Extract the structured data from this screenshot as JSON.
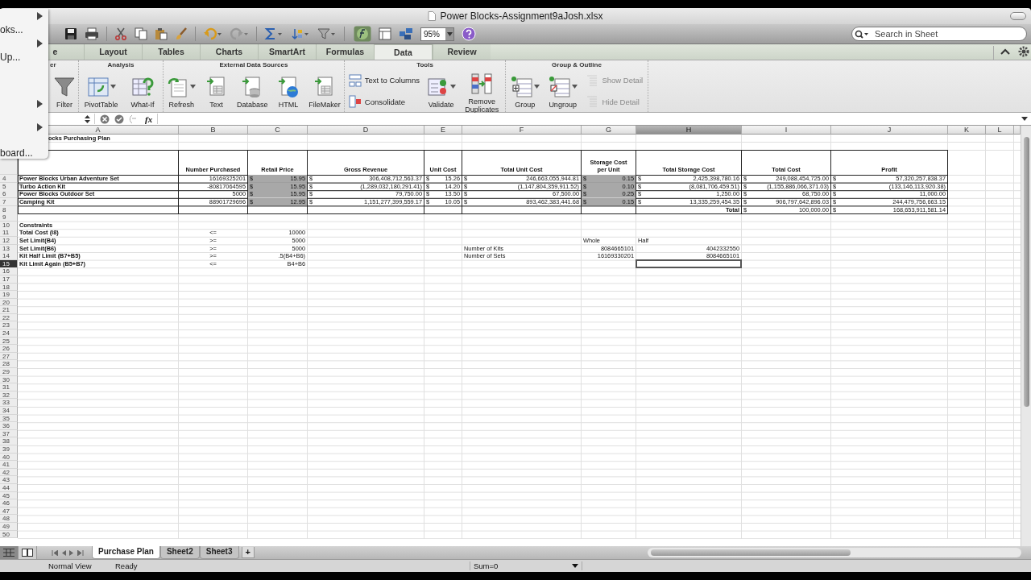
{
  "window": {
    "title": "Power Blocks-Assignment9aJosh.xlsx"
  },
  "menu": [
    {
      "submenu": true
    },
    {
      "label": "oks...",
      "submenu": false
    },
    {
      "submenu": true
    },
    {
      "label": "Up...",
      "submenu": false
    },
    {
      "submenu": true
    },
    {
      "submenu": true
    },
    {
      "label": "board...",
      "submenu": false
    }
  ],
  "toolbar": {
    "zoom": "95%"
  },
  "search": {
    "placeholder": "Search in Sheet"
  },
  "ribbon_tabs": [
    {
      "label": "e",
      "selected": false
    },
    {
      "label": "Layout",
      "selected": false
    },
    {
      "label": "Tables",
      "selected": false
    },
    {
      "label": "Charts",
      "selected": false
    },
    {
      "label": "SmartArt",
      "selected": false
    },
    {
      "label": "Formulas",
      "selected": false
    },
    {
      "label": "Data",
      "selected": true
    },
    {
      "label": "Review",
      "selected": false
    }
  ],
  "ribbon_groups": [
    {
      "title": "er",
      "items": [
        {
          "label": "Filter",
          "kind": "large",
          "dropdown": false,
          "disabled": false
        }
      ]
    },
    {
      "title": "Analysis",
      "items": [
        {
          "label": "PivotTable",
          "kind": "large",
          "dropdown": true,
          "disabled": false
        },
        {
          "label": "What-If",
          "kind": "large",
          "dropdown": false,
          "disabled": false
        }
      ]
    },
    {
      "title": "External Data Sources",
      "items": [
        {
          "label": "Refresh",
          "kind": "large",
          "dropdown": true,
          "disabled": false
        },
        {
          "label": "Text",
          "kind": "large",
          "dropdown": false,
          "disabled": false
        },
        {
          "label": "Database",
          "kind": "large",
          "dropdown": false,
          "disabled": false
        },
        {
          "label": "HTML",
          "kind": "large",
          "dropdown": false,
          "disabled": false
        },
        {
          "label": "FileMaker",
          "kind": "large",
          "dropdown": false,
          "disabled": false
        }
      ]
    },
    {
      "title": "Tools",
      "items": [
        {
          "label": "Text to Columns",
          "kind": "small",
          "dropdown": false,
          "disabled": false
        },
        {
          "label": "Consolidate",
          "kind": "small",
          "dropdown": false,
          "disabled": false
        },
        {
          "label": "Validate",
          "kind": "large",
          "dropdown": true,
          "disabled": false
        },
        {
          "label": "Remove Duplicates",
          "kind": "large",
          "dropdown": false,
          "disabled": false
        }
      ]
    },
    {
      "title": "Group & Outline",
      "items": [
        {
          "label": "Group",
          "kind": "large",
          "dropdown": true,
          "disabled": false
        },
        {
          "label": "Ungroup",
          "kind": "large",
          "dropdown": true,
          "disabled": false
        },
        {
          "label": "Show Detail",
          "kind": "small",
          "dropdown": false,
          "disabled": true
        },
        {
          "label": "Hide Detail",
          "kind": "small",
          "dropdown": false,
          "disabled": true
        }
      ]
    }
  ],
  "formula_bar": {
    "function_label": "fx"
  },
  "columns": [
    {
      "letter": "A",
      "selected": false
    },
    {
      "letter": "B",
      "selected": false
    },
    {
      "letter": "C",
      "selected": false
    },
    {
      "letter": "D",
      "selected": false
    },
    {
      "letter": "E",
      "selected": false
    },
    {
      "letter": "F",
      "selected": false
    },
    {
      "letter": "G",
      "selected": false
    },
    {
      "letter": "H",
      "selected": true
    },
    {
      "letter": "I",
      "selected": false
    },
    {
      "letter": "J",
      "selected": false
    },
    {
      "letter": "K",
      "selected": false
    },
    {
      "letter": "L",
      "selected": false
    }
  ],
  "row_numbers": [
    {
      "label": "4",
      "selected": false
    },
    {
      "label": "5",
      "selected": false
    },
    {
      "label": "6",
      "selected": false
    },
    {
      "label": "7",
      "selected": false
    },
    {
      "label": "8",
      "selected": false
    },
    {
      "label": "9",
      "selected": false
    },
    {
      "label": "10",
      "selected": false
    },
    {
      "label": "11",
      "selected": false
    },
    {
      "label": "12",
      "selected": false
    },
    {
      "label": "13",
      "selected": false
    },
    {
      "label": "14",
      "selected": false
    },
    {
      "label": "15",
      "selected": true
    },
    {
      "label": "16",
      "selected": false
    },
    {
      "label": "17",
      "selected": false
    },
    {
      "label": "18",
      "selected": false
    },
    {
      "label": "19",
      "selected": false
    },
    {
      "label": "20",
      "selected": false
    },
    {
      "label": "21",
      "selected": false
    },
    {
      "label": "22",
      "selected": false
    },
    {
      "label": "23",
      "selected": false
    },
    {
      "label": "24",
      "selected": false
    },
    {
      "label": "25",
      "selected": false
    },
    {
      "label": "26",
      "selected": false
    },
    {
      "label": "27",
      "selected": false
    },
    {
      "label": "28",
      "selected": false
    },
    {
      "label": "29",
      "selected": false
    },
    {
      "label": "30",
      "selected": false
    },
    {
      "label": "31",
      "selected": false
    },
    {
      "label": "32",
      "selected": false
    },
    {
      "label": "33",
      "selected": false
    },
    {
      "label": "34",
      "selected": false
    },
    {
      "label": "35",
      "selected": false
    },
    {
      "label": "36",
      "selected": false
    },
    {
      "label": "37",
      "selected": false
    },
    {
      "label": "38",
      "selected": false
    },
    {
      "label": "39",
      "selected": false
    },
    {
      "label": "40",
      "selected": false
    },
    {
      "label": "41",
      "selected": false
    },
    {
      "label": "42",
      "selected": false
    },
    {
      "label": "43",
      "selected": false
    },
    {
      "label": "44",
      "selected": false
    },
    {
      "label": "45",
      "selected": false
    },
    {
      "label": "46",
      "selected": false
    },
    {
      "label": "47",
      "selected": false
    },
    {
      "label": "48",
      "selected": false
    },
    {
      "label": "49",
      "selected": false
    },
    {
      "label": "50",
      "selected": false
    }
  ],
  "sheet_title": "ocks Purchasing Plan",
  "table": {
    "headers": [
      "Number Purchased",
      "Retail Price",
      "Gross Revenue",
      "Unit Cost",
      "Total Unit Cost",
      "Storage Cost per Unit",
      "Total Storage Cost",
      "Total Cost",
      "Profit"
    ],
    "rows": [
      {
        "item": "Power Blocks Urban Adventure Set",
        "number_purchased": "16169325201",
        "money": [
          [
            "$",
            "15.95"
          ],
          [
            "$",
            "306,408,712,563.37"
          ],
          [
            "$",
            "15.26"
          ],
          [
            "$",
            "246,663,055,944.81"
          ],
          [
            "$",
            "0.15"
          ],
          [
            "$",
            "2,425,398,780.16"
          ],
          [
            "$",
            "249,088,454,725.00"
          ],
          [
            "$",
            "57,320,257,838.37"
          ]
        ]
      },
      {
        "item": "Turbo Action Kit",
        "number_purchased": "-80817064595",
        "money": [
          [
            "$",
            "15.95"
          ],
          [
            "$",
            "(1,289,032,180,291.41)"
          ],
          [
            "$",
            "14.20"
          ],
          [
            "$",
            "(1,147,804,359,911.52)"
          ],
          [
            "$",
            "0.10"
          ],
          [
            "$",
            "(8,081,706,459.51)"
          ],
          [
            "$",
            "(1,155,886,066,371.03)"
          ],
          [
            "$",
            "(133,146,113,920.38)"
          ]
        ]
      },
      {
        "item": "Power Blocks Outdoor Set",
        "number_purchased": "5000",
        "money": [
          [
            "$",
            "15.95"
          ],
          [
            "$",
            "79,750.00"
          ],
          [
            "$",
            "13.50"
          ],
          [
            "$",
            "67,500.00"
          ],
          [
            "$",
            "0.25"
          ],
          [
            "$",
            "1,250.00"
          ],
          [
            "$",
            "68,750.00"
          ],
          [
            "$",
            "11,000.00"
          ]
        ]
      },
      {
        "item": "Camping Kit",
        "number_purchased": "88901729696",
        "money": [
          [
            "$",
            "12.95"
          ],
          [
            "$",
            "1,151,277,399,559.17"
          ],
          [
            "$",
            "10.05"
          ],
          [
            "$",
            "893,462,383,441.68"
          ],
          [
            "$",
            "0.15"
          ],
          [
            "$",
            "13,335,259,454.35"
          ],
          [
            "$",
            "906,797,642,896.03"
          ],
          [
            "$",
            "244,479,756,663.15"
          ]
        ]
      }
    ],
    "total": {
      "label": "Total",
      "total_cost": [
        "$",
        "100,000.00"
      ],
      "profit": [
        "$",
        "168,653,911,581.14"
      ]
    }
  },
  "constraints": {
    "title": "Constraints",
    "rows": [
      {
        "label": "Total Cost (I8)",
        "operator": "<=",
        "value": "10000"
      },
      {
        "label": "Set Limit(B4)",
        "operator": ">=",
        "value": "5000"
      },
      {
        "label": "Set Limit(B6)",
        "operator": ">=",
        "value": "5000"
      },
      {
        "label": "Kit Half Limit (B7+B5)",
        "operator": ">=",
        "value": ".5(B4+B6)"
      },
      {
        "label": "Kit Limit Again (B5+B7)",
        "operator": "<=",
        "value": "B4+B6"
      }
    ]
  },
  "counts": {
    "headers": [
      "Whole",
      "Half"
    ],
    "rows": [
      {
        "label": "Number of Kits",
        "whole": "8084665101",
        "half": "4042332550"
      },
      {
        "label": "Number of Sets",
        "whole": "16169330201",
        "half": "8084665101"
      }
    ]
  },
  "sheet_tabs": [
    {
      "label": "Purchase Plan",
      "selected": true
    },
    {
      "label": "Sheet2",
      "selected": false
    },
    {
      "label": "Sheet3",
      "selected": false
    }
  ],
  "add_sheet": "+",
  "status_bar": {
    "view": "Normal View",
    "state": "Ready",
    "sum": "Sum=0"
  }
}
